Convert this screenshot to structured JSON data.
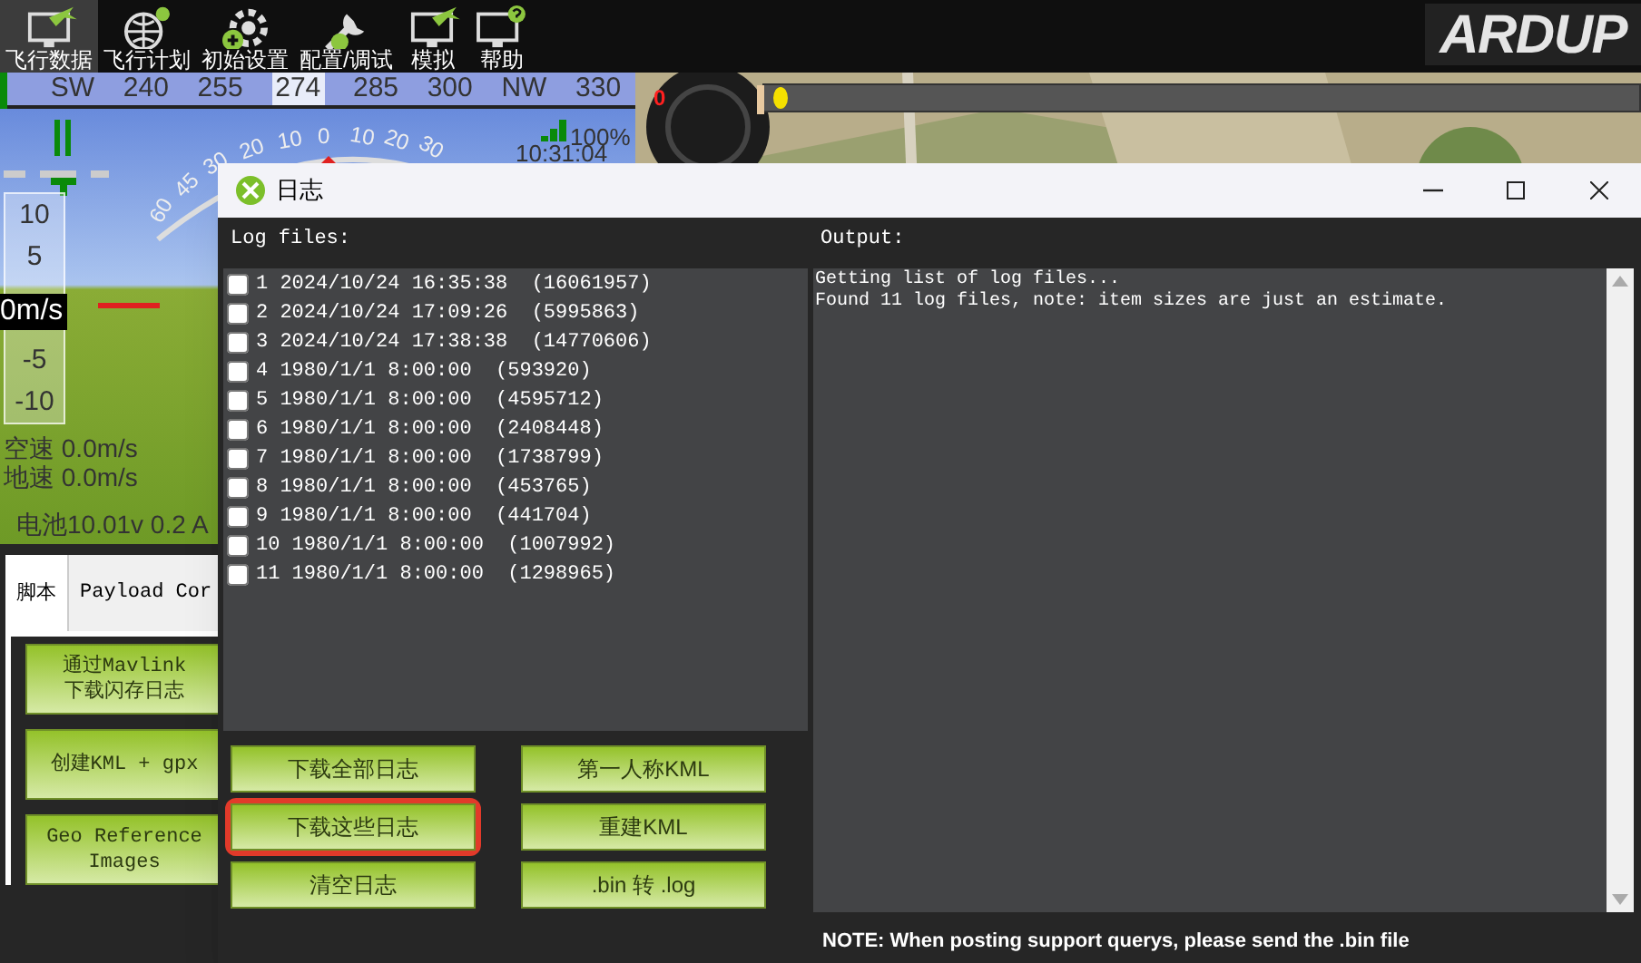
{
  "toolbar": {
    "items": [
      {
        "label": "飞行数据",
        "selected": true
      },
      {
        "label": "飞行计划",
        "selected": false
      },
      {
        "label": "初始设置",
        "selected": false
      },
      {
        "label": "配置/调试",
        "selected": false
      },
      {
        "label": "模拟",
        "selected": false
      },
      {
        "label": "帮助",
        "selected": false
      }
    ],
    "logo": "ARDUP"
  },
  "hud": {
    "compass": [
      "SW",
      "240",
      "255",
      "274",
      "285",
      "300",
      "NW",
      "330"
    ],
    "pitch_labels": [
      "60",
      "45",
      "30",
      "20",
      "10",
      "0",
      "10",
      "20",
      "30"
    ],
    "battery_percent": "100%",
    "clock": "10:31:04",
    "speed_scale": [
      "10",
      "5",
      "-5",
      "-10"
    ],
    "speed": "0m/s",
    "airspeed": "空速 0.0m/s",
    "groundspeed": "地速 0.0m/s",
    "battery": "电池10.01v 0.2 A"
  },
  "map": {
    "kind": "picture",
    "gauge_reading": "0"
  },
  "side_panel": {
    "tabs": [
      {
        "label": "脚本",
        "selected": true
      },
      {
        "label": "Payload Cor",
        "selected": false
      }
    ],
    "buttons": [
      "通过Mavlink\n下载闪存日志",
      "创建KML + gpx",
      "Geo Reference\nImages"
    ]
  },
  "dialog": {
    "title": "日志",
    "log_files_label": "Log files:",
    "logs": [
      {
        "label": "1 2024/10/24 16:35:38  (16061957)",
        "checked": false
      },
      {
        "label": "2 2024/10/24 17:09:26  (5995863)",
        "checked": false
      },
      {
        "label": "3 2024/10/24 17:38:38  (14770606)",
        "checked": false
      },
      {
        "label": "4 1980/1/1 8:00:00  (593920)",
        "checked": false
      },
      {
        "label": "5 1980/1/1 8:00:00  (4595712)",
        "checked": false
      },
      {
        "label": "6 1980/1/1 8:00:00  (2408448)",
        "checked": false
      },
      {
        "label": "7 1980/1/1 8:00:00  (1738799)",
        "checked": false
      },
      {
        "label": "8 1980/1/1 8:00:00  (453765)",
        "checked": false
      },
      {
        "label": "9 1980/1/1 8:00:00  (441704)",
        "checked": false
      },
      {
        "label": "10 1980/1/1 8:00:00  (1007992)",
        "checked": false
      },
      {
        "label": "11 1980/1/1 8:00:00  (1298965)",
        "checked": false
      }
    ],
    "output_label": "Output:",
    "output_lines": [
      "Getting list of log files...",
      "Found 11 log files, note: item sizes are just an estimate."
    ],
    "buttons": [
      {
        "label": "下载全部日志",
        "highlighted": false
      },
      {
        "label": "第一人称KML",
        "highlighted": false
      },
      {
        "label": "下载这些日志",
        "highlighted": true
      },
      {
        "label": "重建KML",
        "highlighted": false
      },
      {
        "label": "清空日志",
        "highlighted": false
      },
      {
        "label": ".bin 转 .log",
        "highlighted": false
      }
    ],
    "note": "NOTE: When posting support querys, please send the .bin file"
  }
}
